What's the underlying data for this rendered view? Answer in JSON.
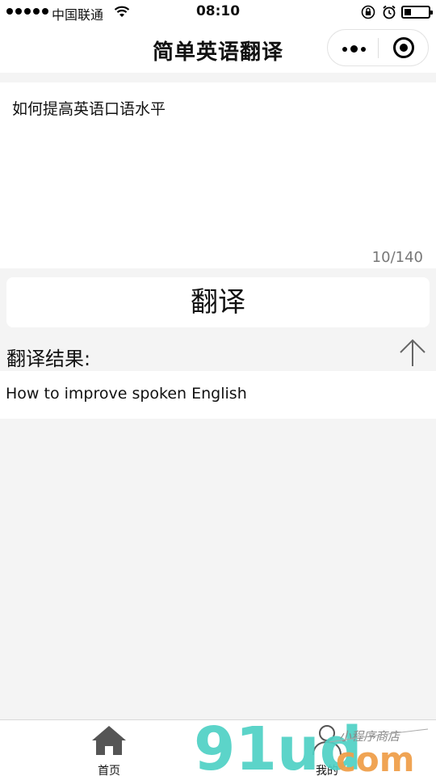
{
  "status_bar": {
    "carrier": "中国联通",
    "time": "08:10",
    "icons": [
      "signal-dots",
      "wifi-icon",
      "rotation-lock-icon",
      "alarm-icon",
      "battery-icon"
    ]
  },
  "nav": {
    "title": "简单英语翻译",
    "capsule_icons": [
      "more-icon",
      "close-target-icon"
    ]
  },
  "input": {
    "value": "如何提高英语口语水平",
    "counter": "10/140"
  },
  "translate_button": {
    "label": "翻译"
  },
  "result": {
    "header": "翻译结果:",
    "text": "How to improve spoken English",
    "icons": [
      "up-arrow-icon"
    ]
  },
  "tab_bar": {
    "tabs": [
      {
        "label": "首页",
        "icon": "home-icon"
      },
      {
        "label": "我的",
        "icon": "user-icon"
      }
    ]
  },
  "watermark": {
    "brand": "91ud",
    "domain": "com",
    "tagline": "小程序商店"
  },
  "colors": {
    "background": "#f4f4f4",
    "surface": "#ffffff",
    "watermark_teal": "#4fd1c5",
    "watermark_orange": "#f0a04b"
  }
}
